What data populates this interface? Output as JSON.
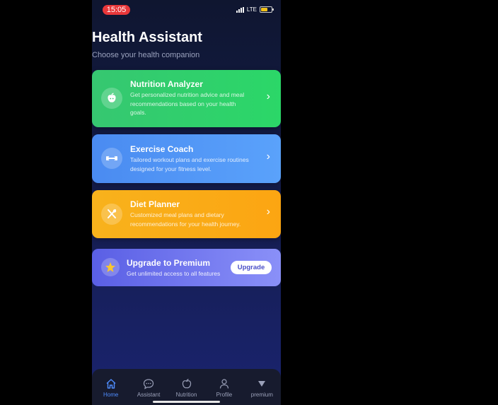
{
  "status_bar": {
    "time": "15:05",
    "network": "LTE"
  },
  "header": {
    "title": "Health Assistant",
    "subtitle": "Choose your health companion"
  },
  "cards": [
    {
      "title": "Nutrition Analyzer",
      "description": "Get personalized nutrition advice and meal recommendations based on your health goals.",
      "icon": "apple-icon",
      "color": "#34c870"
    },
    {
      "title": "Exercise Coach",
      "description": "Tailored workout plans and exercise routines designed for your fitness level.",
      "icon": "dumbbell-icon",
      "color": "#4f93f5"
    },
    {
      "title": "Diet Planner",
      "description": "Customized meal plans and dietary recommendations for your health journey.",
      "icon": "utensils-icon",
      "color": "#f9ad17"
    }
  ],
  "premium": {
    "title": "Upgrade to Premium",
    "description": "Get unlimited access to all features",
    "button_label": "Upgrade",
    "icon": "star-icon"
  },
  "tab_bar": {
    "tabs": [
      {
        "label": "Home",
        "icon": "home-icon",
        "active": true
      },
      {
        "label": "Assistant",
        "icon": "chat-icon",
        "active": false
      },
      {
        "label": "Nutrition",
        "icon": "apple-icon",
        "active": false
      },
      {
        "label": "Profile",
        "icon": "person-icon",
        "active": false
      },
      {
        "label": "premium",
        "icon": "triangle-down-icon",
        "active": false
      }
    ]
  },
  "colors": {
    "accent": "#4f8dff",
    "status_pill": "#e8373a",
    "background": "#141c4a"
  }
}
